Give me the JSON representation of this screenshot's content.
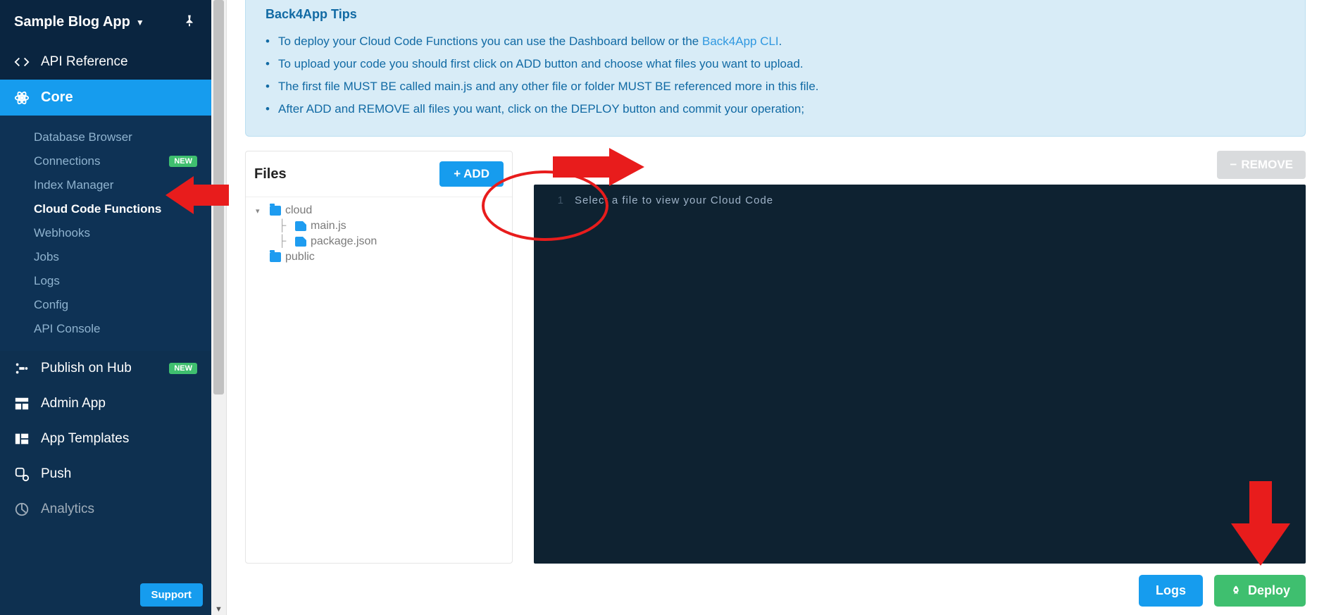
{
  "app": {
    "title": "Sample Blog App"
  },
  "nav": {
    "apiReference": "API Reference",
    "core": "Core",
    "coreItems": [
      {
        "label": "Database Browser",
        "active": false,
        "new": false
      },
      {
        "label": "Connections",
        "active": false,
        "new": true
      },
      {
        "label": "Index Manager",
        "active": false,
        "new": false
      },
      {
        "label": "Cloud Code Functions",
        "active": true,
        "new": false
      },
      {
        "label": "Webhooks",
        "active": false,
        "new": false
      },
      {
        "label": "Jobs",
        "active": false,
        "new": false
      },
      {
        "label": "Logs",
        "active": false,
        "new": false
      },
      {
        "label": "Config",
        "active": false,
        "new": false
      },
      {
        "label": "API Console",
        "active": false,
        "new": false
      }
    ],
    "publishOnHub": "Publish on Hub",
    "adminApp": "Admin App",
    "appTemplates": "App Templates",
    "push": "Push",
    "analytics": "Analytics"
  },
  "badges": {
    "newLabel": "NEW"
  },
  "support": "Support",
  "tips": {
    "title": "Back4App Tips",
    "items": [
      {
        "pre": "To deploy your Cloud Code Functions you can use the Dashboard bellow or the ",
        "link": "Back4App CLI",
        "post": "."
      },
      {
        "pre": "To upload your code you should first click on ADD button and choose what files you want to upload.",
        "link": "",
        "post": ""
      },
      {
        "pre": "The first file MUST BE called main.js and any other file or folder MUST BE referenced more in this file.",
        "link": "",
        "post": ""
      },
      {
        "pre": "After ADD and REMOVE all files you want, click on the DEPLOY button and commit your operation;",
        "link": "",
        "post": ""
      }
    ]
  },
  "files": {
    "title": "Files",
    "addLabel": "ADD",
    "tree": [
      {
        "type": "folder",
        "name": "cloud",
        "depth": 0
      },
      {
        "type": "file",
        "name": "main.js",
        "depth": 1
      },
      {
        "type": "file",
        "name": "package.json",
        "depth": 1
      },
      {
        "type": "folder",
        "name": "public",
        "depth": 0
      }
    ]
  },
  "editor": {
    "removeLabel": "REMOVE",
    "lineNo": "1",
    "placeholder": "Select a file to view your Cloud Code"
  },
  "footer": {
    "logs": "Logs",
    "deploy": "Deploy"
  }
}
